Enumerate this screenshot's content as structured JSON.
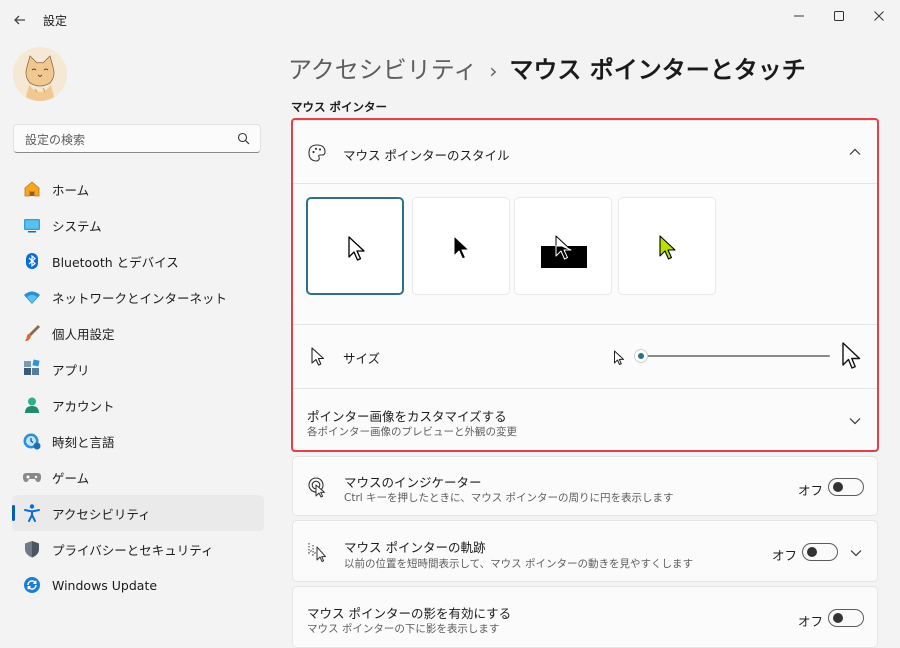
{
  "window": {
    "title": "設定"
  },
  "search": {
    "placeholder": "設定の検索"
  },
  "sidebar": {
    "items": [
      {
        "label": "ホーム",
        "icon": "home-icon"
      },
      {
        "label": "システム",
        "icon": "system-icon"
      },
      {
        "label": "Bluetooth とデバイス",
        "icon": "bluetooth-icon"
      },
      {
        "label": "ネットワークとインターネット",
        "icon": "network-icon"
      },
      {
        "label": "個人用設定",
        "icon": "brush-icon"
      },
      {
        "label": "アプリ",
        "icon": "apps-icon"
      },
      {
        "label": "アカウント",
        "icon": "account-icon"
      },
      {
        "label": "時刻と言語",
        "icon": "time-language-icon"
      },
      {
        "label": "ゲーム",
        "icon": "gaming-icon"
      },
      {
        "label": "アクセシビリティ",
        "icon": "accessibility-icon",
        "active": true
      },
      {
        "label": "プライバシーとセキュリティ",
        "icon": "shield-icon"
      },
      {
        "label": "Windows Update",
        "icon": "update-icon"
      }
    ]
  },
  "header": {
    "breadcrumb_parent": "アクセシビリティ",
    "breadcrumb_separator": "›",
    "breadcrumb_current": "マウス ポインターとタッチ"
  },
  "section": {
    "label": "マウス ポインター"
  },
  "pointer_style": {
    "title": "マウス ポインターのスタイル",
    "options": [
      "white",
      "black",
      "inverted",
      "custom-lime"
    ],
    "selected": "white",
    "custom_color": "#b8e000"
  },
  "size": {
    "title": "サイズ",
    "level": 1,
    "min": 1,
    "max": 15
  },
  "customize": {
    "title": "ポインター画像をカスタマイズする",
    "subtitle": "各ポインター画像のプレビューと外観の変更"
  },
  "indicator": {
    "title": "マウスのインジケーター",
    "subtitle": "Ctrl キーを押したときに、マウス ポインターの周りに円を表示します",
    "state": "オフ"
  },
  "trails": {
    "title": "マウス ポインターの軌跡",
    "subtitle": "以前の位置を短時間表示して、マウス ポインターの動きを見やすくします",
    "state": "オフ"
  },
  "shadow": {
    "title": "マウス ポインターの影を有効にする",
    "subtitle": "マウス ポインターの下に影を表示します",
    "state": "オフ"
  },
  "colors": {
    "accent": "#005fb8",
    "slider_accent": "#2b7286",
    "highlight": "#e0414b"
  }
}
